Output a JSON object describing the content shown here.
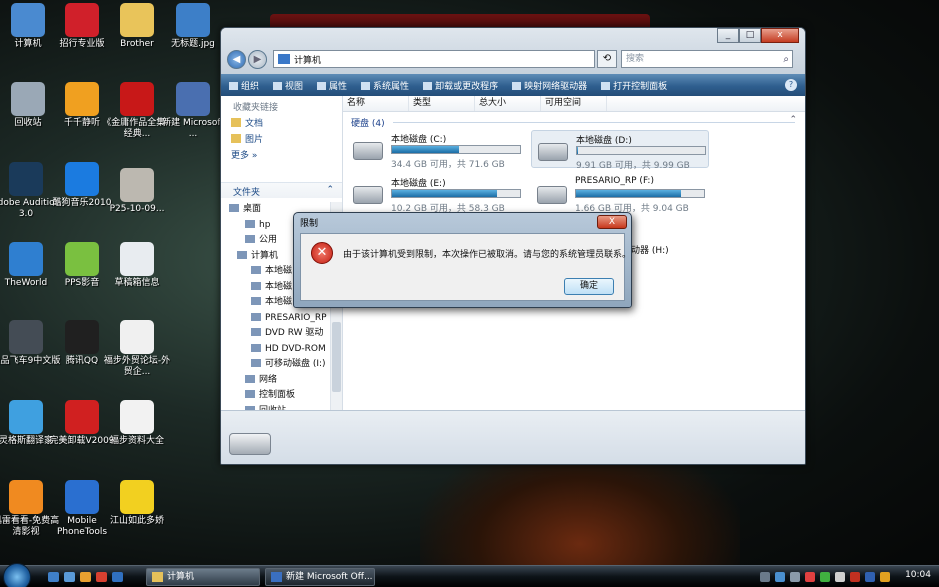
{
  "desktop": {
    "icons": [
      {
        "label": "计算机",
        "color": "#4a8ad0"
      },
      {
        "label": "招行专业版",
        "color": "#d0202a"
      },
      {
        "label": "Brother",
        "color": "#e9c45a"
      },
      {
        "label": "无标题.jpg",
        "color": "#3d7fc8"
      },
      {
        "label": "回收站",
        "color": "#9aa8b6"
      },
      {
        "label": "千千静听",
        "color": "#f0a020"
      },
      {
        "label": "《金庸作品全集--经典...",
        "color": "#c81818"
      },
      {
        "label": "新建 Microsoft ...",
        "color": "#4a6fb0"
      },
      {
        "label": "Adobe Audition 3.0",
        "color": "#1a3a5a"
      },
      {
        "label": "酷狗音乐2010",
        "color": "#1b7be0"
      },
      {
        "label": "P25-10-09...",
        "color": "#bcb8b0"
      },
      {
        "label": "TheWorld",
        "color": "#2f7fd0"
      },
      {
        "label": "PPS影音",
        "color": "#7ac040"
      },
      {
        "label": "草稿箱信息",
        "color": "#e8ecf0"
      },
      {
        "label": "极品飞车9中文版",
        "color": "#444c55"
      },
      {
        "label": "腾讯QQ",
        "color": "#202020"
      },
      {
        "label": "福步外贸论坛-外贸企...",
        "color": "#f0f0f0"
      },
      {
        "label": "灵格斯翻译家",
        "color": "#3fa0e0"
      },
      {
        "label": "完美卸载V2009",
        "color": "#d02020"
      },
      {
        "label": "福步资料大全",
        "color": "#f2f2f2"
      },
      {
        "label": "迅雷看看-免费高清影视",
        "color": "#f08a20"
      },
      {
        "label": "Mobile PhoneTools",
        "color": "#2a6fd0"
      },
      {
        "label": "江山如此多娇",
        "color": "#f2d020"
      }
    ]
  },
  "explorer": {
    "address_label": "计算机",
    "search_placeholder": "搜索",
    "toolbar": [
      "组织",
      "视图",
      "属性",
      "系统属性",
      "卸载或更改程序",
      "映射网络驱动器",
      "打开控制面板"
    ],
    "favorites_header": "收藏夹链接",
    "favorites": [
      "文档",
      "图片",
      "更多 »"
    ],
    "folders_header": "文件夹",
    "tree": [
      "桌面",
      "hp",
      "公用",
      "计算机",
      "本地磁",
      "本地磁",
      "本地磁",
      "PRESARIO_RP",
      "DVD RW 驱动",
      "HD DVD-ROM",
      "可移动磁盘 (I:)",
      "网络",
      "控制面板",
      "回收站"
    ],
    "columns": [
      "名称",
      "类型",
      "总大小",
      "可用空间"
    ],
    "group_label": "硬盘 (4)",
    "drives": [
      {
        "name": "本地磁盘 (C:)",
        "free": "34.4 GB 可用，共 71.6 GB",
        "used": 0.52
      },
      {
        "name": "本地磁盘 (D:)",
        "free": "9.91 GB 可用，共 9.99 GB",
        "used": 0.01
      },
      {
        "name": "本地磁盘 (E:)",
        "free": "10.2 GB 可用，共 58.3 GB",
        "used": 0.82
      },
      {
        "name": "PRESARIO_RP (F:)",
        "free": "1.66 GB 可用，共 9.04 GB",
        "used": 0.82
      }
    ],
    "hidden_drive_label": "动器 (H:)"
  },
  "dialog": {
    "title": "限制",
    "close": "X",
    "message": "由于该计算机受到限制，本次操作已被取消。请与您的系统管理员联系。",
    "ok": "确定"
  },
  "taskbar": {
    "tasks": [
      "计算机",
      "新建 Microsoft Off..."
    ],
    "clock": "10:04"
  }
}
